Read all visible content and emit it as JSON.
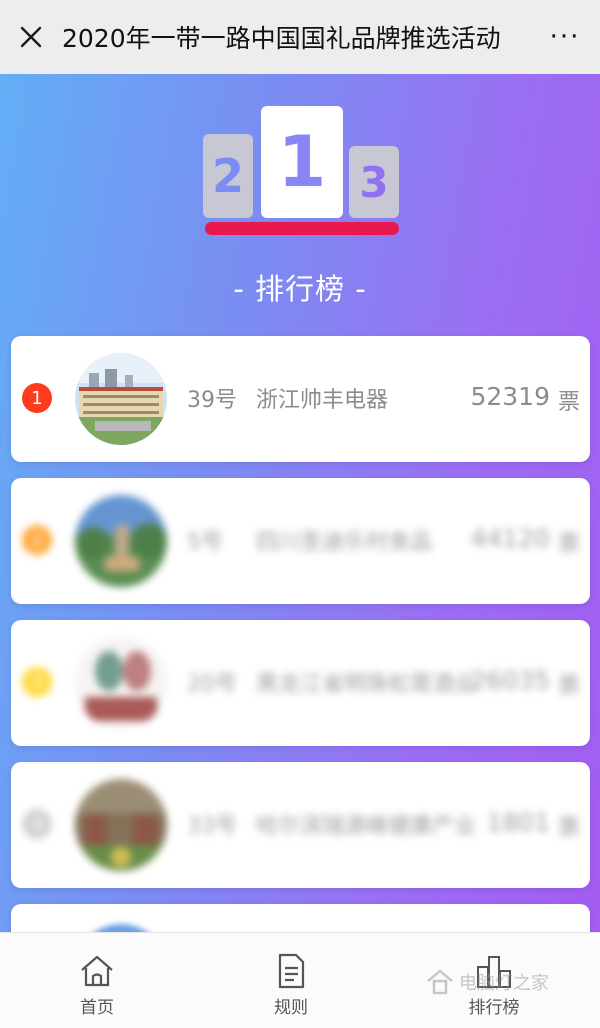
{
  "header": {
    "close_icon": "close-icon",
    "title": "2020年一带一路中国国礼品牌推选活动",
    "more_label": "···"
  },
  "hero": {
    "podium": {
      "first": "1",
      "second": "2",
      "third": "3"
    },
    "title": "- 排行榜 -",
    "accent_color": "#e8194f"
  },
  "rankings": [
    {
      "rank": "1",
      "badge_color": "#ff3b1f",
      "number": "39号",
      "name": "浙江帅丰电器",
      "votes": "52319",
      "unit": "票"
    },
    {
      "rank": "2",
      "badge_color": "#ff9a1a",
      "number": "5号",
      "name": "四川圣迪乐村食品",
      "votes": "44120",
      "unit": "票"
    },
    {
      "rank": "3",
      "badge_color": "#ffd21a",
      "number": "20号",
      "name": "黑龙江省明珠松茸酒业",
      "votes": "26035",
      "unit": "票"
    },
    {
      "rank": "4",
      "badge_color": "#c9c9c9",
      "number": "33号",
      "name": "哈尔滨瑞源峰健康产业",
      "votes": "1801",
      "unit": "票"
    }
  ],
  "tabbar": {
    "home": "首页",
    "rules": "规则",
    "ranking": "排行榜"
  },
  "watermark": "电脑灯之家"
}
